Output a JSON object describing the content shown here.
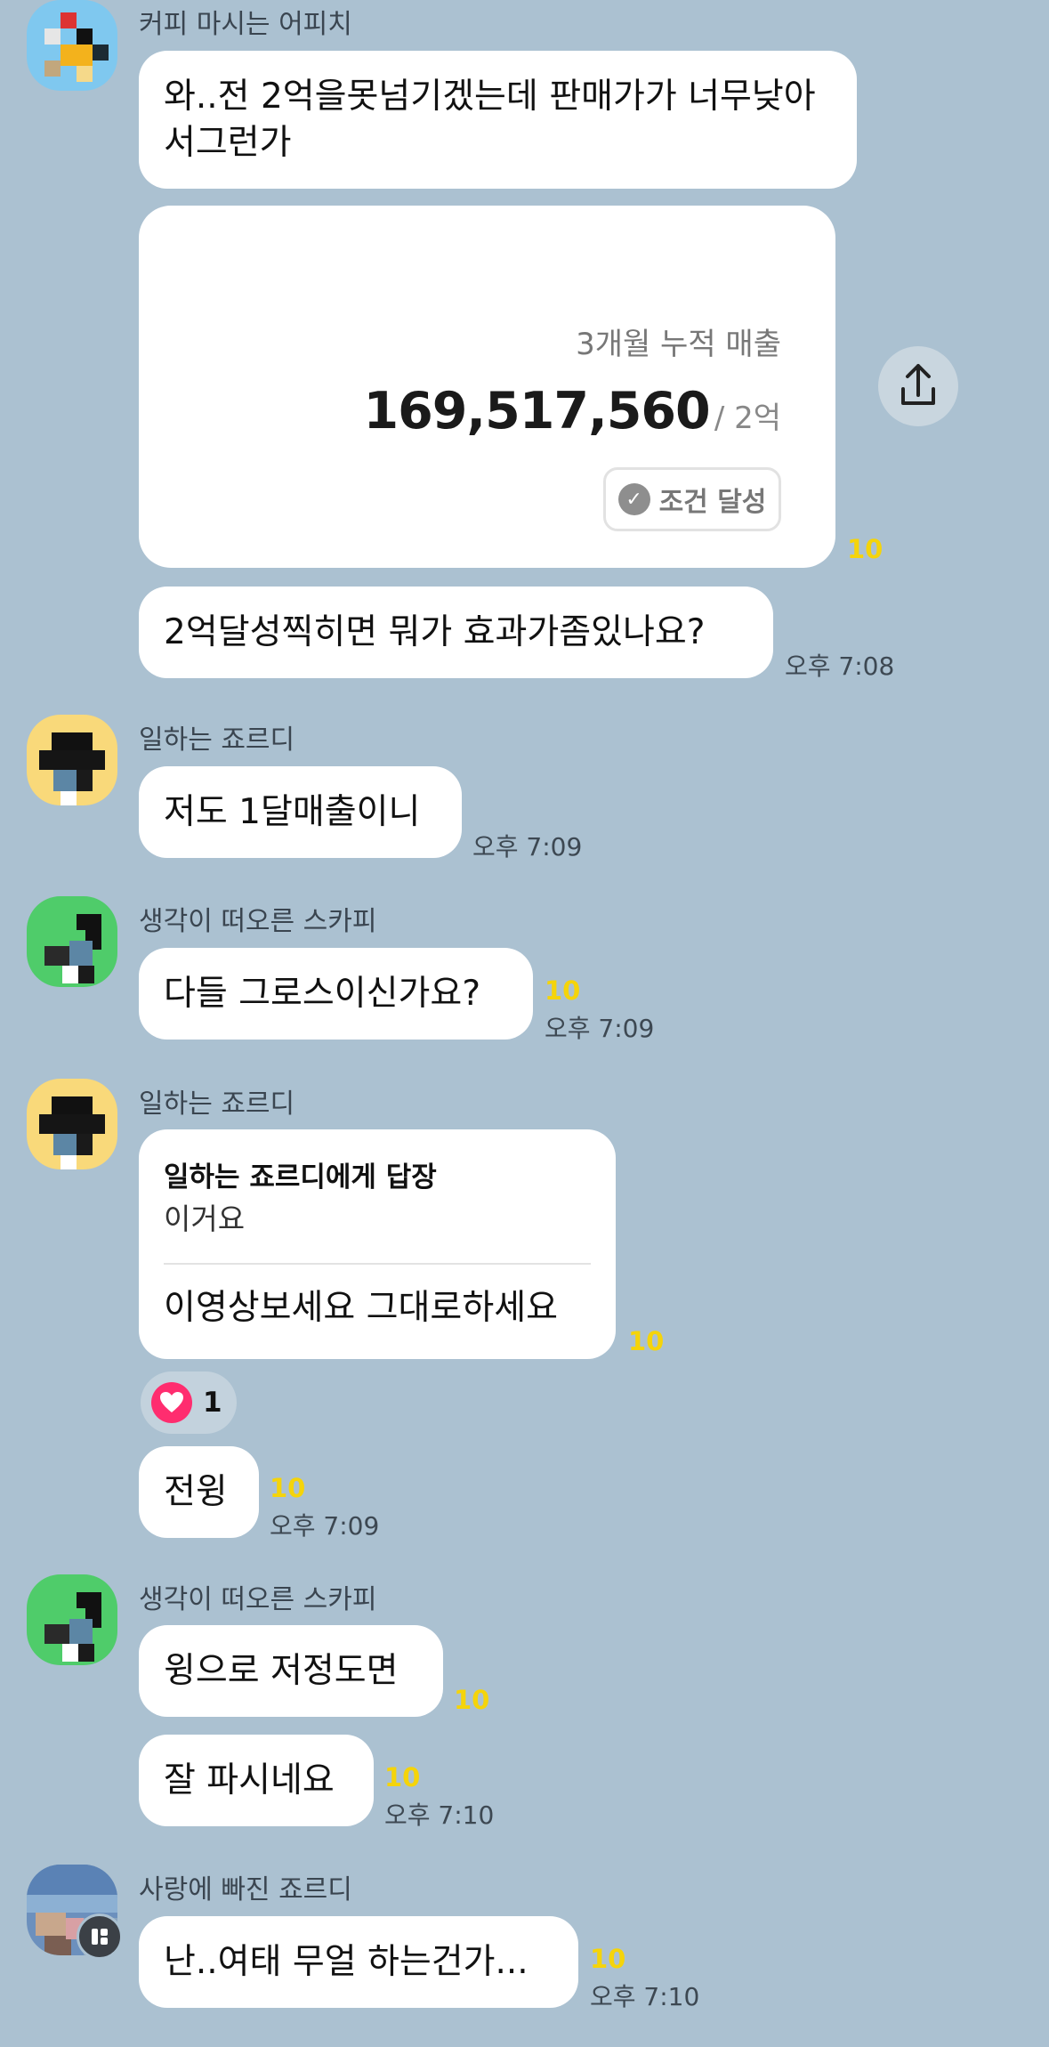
{
  "messages": {
    "m1": {
      "sender": "커피 마시는 어피치",
      "text1": "와..전 2억을못넘기겠는데 판매가가 너무낮아서그런가",
      "card": {
        "title": "3개월 누적 매출",
        "amount": "169,517,560",
        "target": "/ 2억",
        "badge": "조건 달성"
      },
      "card_unread": "10",
      "text2": "2억달성찍히면 뭐가 효과가좀있나요?",
      "time": "오후 7:08"
    },
    "m2": {
      "sender": "일하는 죠르디",
      "text": "저도 1달매출이니",
      "time": "오후 7:09"
    },
    "m3": {
      "sender": "생각이 떠오른 스카피",
      "text": "다들 그로스이신가요?",
      "unread": "10",
      "time": "오후 7:09"
    },
    "m4": {
      "sender": "일하는 죠르디",
      "reply_to": "일하는 죠르디에게 답장",
      "quoted": "이거요",
      "text": "이영상보세요 그대로하세요",
      "unread": "10",
      "reaction_count": "1",
      "text2": "전윙",
      "unread2": "10",
      "time": "오후 7:09"
    },
    "m5": {
      "sender": "생각이 떠오른 스카피",
      "text1": "윙으로 저정도면",
      "unread1": "10",
      "text2": "잘 파시네요",
      "unread2": "10",
      "time": "오후 7:10"
    },
    "m6": {
      "sender": "사랑에 빠진 죠르디",
      "text": "난..여태 무얼 하는건가...",
      "unread": "10",
      "time": "오후 7:10"
    }
  },
  "colors": {
    "background": "#abc1d1",
    "bubble": "#ffffff",
    "unread": "#f5d40a",
    "heart": "#ff2d6f"
  }
}
